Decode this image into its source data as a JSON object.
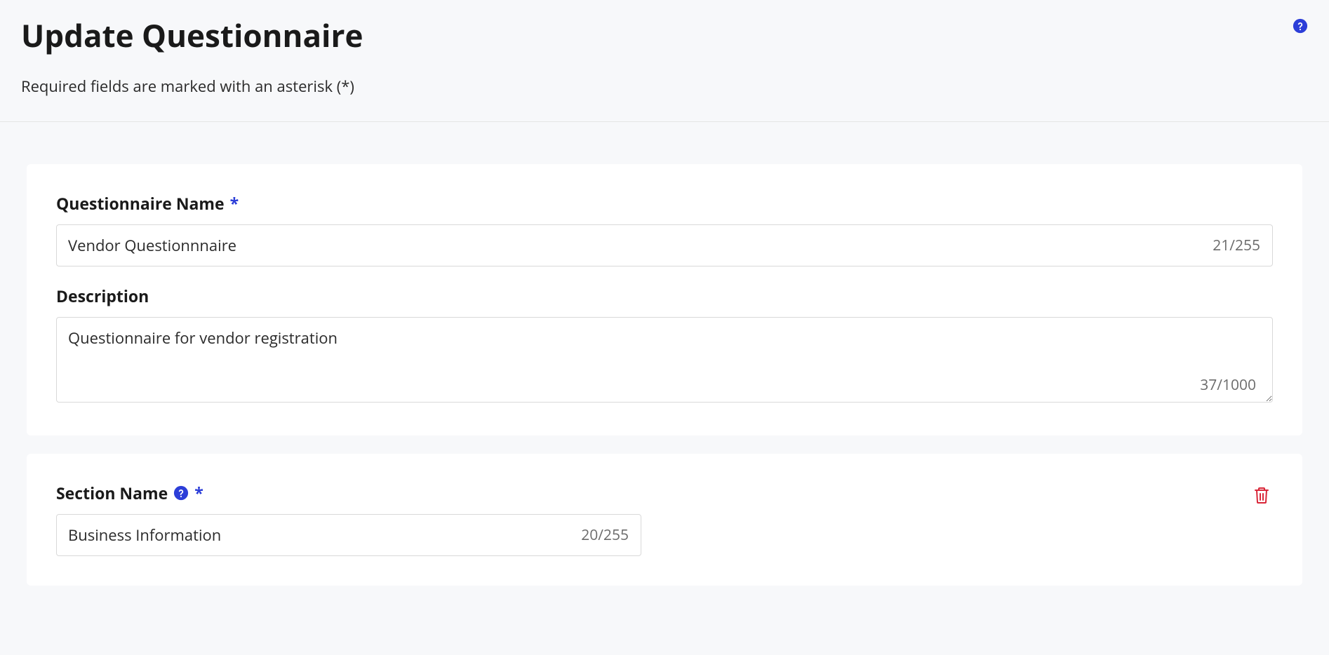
{
  "header": {
    "title": "Update Questionnaire",
    "subtitle": "Required fields are marked with an asterisk (*)"
  },
  "form": {
    "questionnaire_name_label": "Questionnaire Name",
    "questionnaire_name_value": "Vendor Questionnnaire",
    "questionnaire_name_count": "21/255",
    "description_label": "Description",
    "description_value": "Questionnaire for vendor registration",
    "description_count": "37/1000",
    "required_mark": "*"
  },
  "section": {
    "section_name_label": "Section Name",
    "section_name_value": "Business Information",
    "section_name_count": "20/255",
    "required_mark": "*"
  }
}
